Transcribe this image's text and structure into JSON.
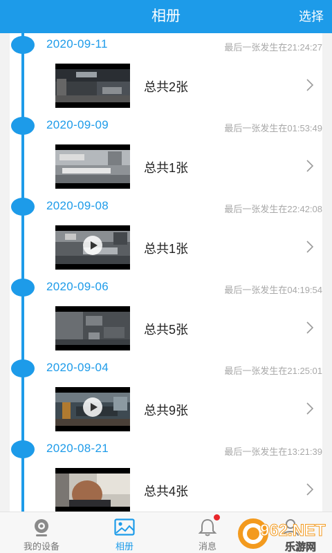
{
  "header": {
    "title": "相册",
    "select_label": "选择"
  },
  "groups": [
    {
      "date": "2020-09-11",
      "last_shot": "最后一张发生在21:24:27",
      "count_label": "总共2张",
      "is_video": false
    },
    {
      "date": "2020-09-09",
      "last_shot": "最后一张发生在01:53:49",
      "count_label": "总共1张",
      "is_video": false
    },
    {
      "date": "2020-09-08",
      "last_shot": "最后一张发生在22:42:08",
      "count_label": "总共1张",
      "is_video": true
    },
    {
      "date": "2020-09-06",
      "last_shot": "最后一张发生在04:19:54",
      "count_label": "总共5张",
      "is_video": false
    },
    {
      "date": "2020-09-04",
      "last_shot": "最后一张发生在21:25:01",
      "count_label": "总共9张",
      "is_video": true
    },
    {
      "date": "2020-08-21",
      "last_shot": "最后一张发生在13:21:39",
      "count_label": "总共4张",
      "is_video": false
    }
  ],
  "tabs": [
    {
      "label": "我的设备",
      "icon": "camera-icon",
      "active": false
    },
    {
      "label": "相册",
      "icon": "photo-album-icon",
      "active": true
    },
    {
      "label": "消息",
      "icon": "bell-icon",
      "active": false,
      "badge": true
    },
    {
      "label": "",
      "icon": "person-icon",
      "active": false
    }
  ],
  "watermark": {
    "text": "962.NET",
    "subtext": "乐游网"
  },
  "colors": {
    "accent": "#1d9be9",
    "badge": "#e8262b",
    "background": "#f2f2f2"
  }
}
